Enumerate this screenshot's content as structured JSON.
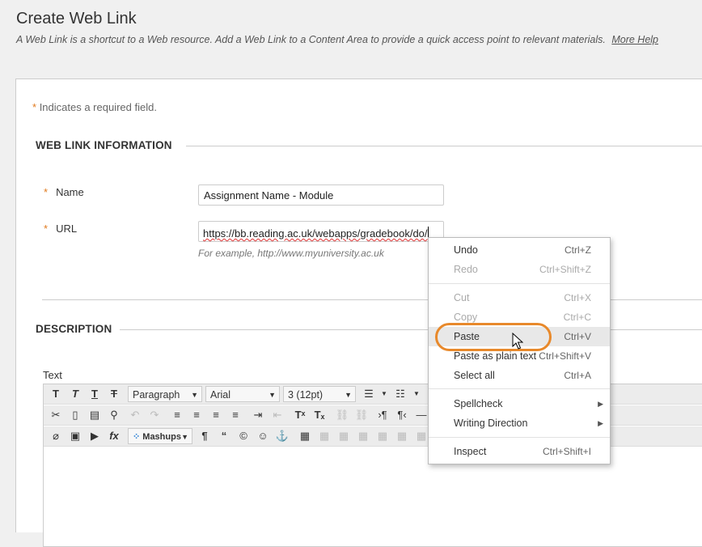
{
  "page": {
    "title": "Create Web Link",
    "description": "A Web Link is a shortcut to a Web resource. Add a Web Link to a Content Area to provide a quick access point to relevant materials.",
    "help_link": "More Help"
  },
  "form": {
    "required_star": "*",
    "required_note": "Indicates a required field.",
    "section_info": "WEB LINK INFORMATION",
    "name_label": "Name",
    "name_value": "Assignment Name - Module",
    "url_label": "URL",
    "url_value": "https://bb.reading.ac.uk/webapps/gradebook/do/",
    "url_hint": "For example, http://www.myuniversity.ac.uk",
    "section_desc": "DESCRIPTION",
    "text_label": "Text"
  },
  "toolbar": {
    "format_select": "Paragraph",
    "font_select": "Arial",
    "size_select": "3 (12pt)",
    "mashups": "Mashups"
  },
  "context_menu": {
    "undo": "Undo",
    "undo_sc": "Ctrl+Z",
    "redo": "Redo",
    "redo_sc": "Ctrl+Shift+Z",
    "cut": "Cut",
    "cut_sc": "Ctrl+X",
    "copy": "Copy",
    "copy_sc": "Ctrl+C",
    "paste": "Paste",
    "paste_sc": "Ctrl+V",
    "paste_plain": "Paste as plain text",
    "paste_plain_sc": "Ctrl+Shift+V",
    "select_all": "Select all",
    "select_all_sc": "Ctrl+A",
    "spellcheck": "Spellcheck",
    "writing_direction": "Writing Direction",
    "inspect": "Inspect",
    "inspect_sc": "Ctrl+Shift+I"
  },
  "colors": {
    "accent": "#e8892b",
    "required": "#e07a1e"
  }
}
